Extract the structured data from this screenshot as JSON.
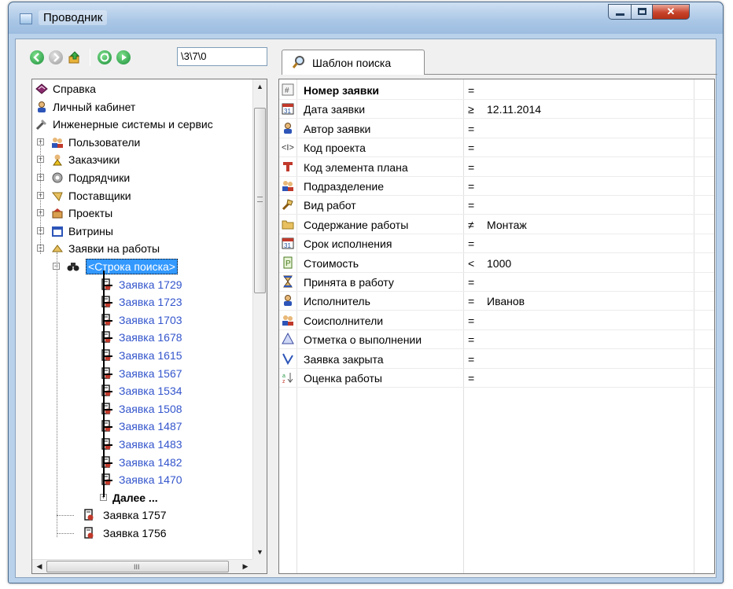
{
  "window": {
    "title": "Проводник"
  },
  "toolbar": {
    "buttons": [
      {
        "name": "back-icon",
        "color": "#2aa84a"
      },
      {
        "name": "forward-icon",
        "color": "#a9a9a9"
      },
      {
        "name": "up-folder-icon",
        "color": "#e0a020"
      },
      {
        "name": "refresh-icon",
        "color": "#2aa84a"
      },
      {
        "name": "go-icon",
        "color": "#2aa84a"
      }
    ],
    "path": "\\3\\7\\0",
    "tab_label": "Шаблон поиска"
  },
  "tree": {
    "items": [
      {
        "label": "Справка",
        "level": 0,
        "icon": "book-icon"
      },
      {
        "label": "Личный кабинет",
        "level": 0,
        "icon": "user-icon"
      },
      {
        "label": "Инженерные системы и сервис",
        "level": 0,
        "icon": "tools-icon"
      },
      {
        "label": "Пользователи",
        "level": 1,
        "icon": "users-icon",
        "expander": "+"
      },
      {
        "label": "Заказчики",
        "level": 1,
        "icon": "customer-icon",
        "expander": "+"
      },
      {
        "label": "Подрядчики",
        "level": 1,
        "icon": "contractor-icon",
        "expander": "+"
      },
      {
        "label": "Поставщики",
        "level": 1,
        "icon": "supplier-icon",
        "expander": "+"
      },
      {
        "label": "Проекты",
        "level": 1,
        "icon": "projects-icon",
        "expander": "+"
      },
      {
        "label": "Витрины",
        "level": 1,
        "icon": "showcase-icon",
        "expander": "+"
      },
      {
        "label": "Заявки на работы",
        "level": 1,
        "icon": "requests-icon",
        "expander": "−"
      },
      {
        "label": "<Строка поиска>",
        "level": 2,
        "icon": "binoculars-icon",
        "expander": "−",
        "selected": true
      },
      {
        "label": "Заявка 1729",
        "level": 3,
        "icon": "request-doc-icon",
        "link": true
      },
      {
        "label": "Заявка 1723",
        "level": 3,
        "icon": "request-doc-icon",
        "link": true
      },
      {
        "label": "Заявка 1703",
        "level": 3,
        "icon": "request-doc-icon",
        "link": true
      },
      {
        "label": "Заявка 1678",
        "level": 3,
        "icon": "request-doc-icon",
        "link": true
      },
      {
        "label": "Заявка 1615",
        "level": 3,
        "icon": "request-doc-icon",
        "link": true
      },
      {
        "label": "Заявка 1567",
        "level": 3,
        "icon": "request-doc-icon",
        "link": true
      },
      {
        "label": "Заявка 1534",
        "level": 3,
        "icon": "request-doc-icon",
        "link": true
      },
      {
        "label": "Заявка 1508",
        "level": 3,
        "icon": "request-doc-icon",
        "link": true
      },
      {
        "label": "Заявка 1487",
        "level": 3,
        "icon": "request-doc-icon",
        "link": true
      },
      {
        "label": "Заявка 1483",
        "level": 3,
        "icon": "request-doc-icon",
        "link": true
      },
      {
        "label": "Заявка 1482",
        "level": 3,
        "icon": "request-doc-icon",
        "link": true
      },
      {
        "label": "Заявка 1470",
        "level": 3,
        "icon": "request-doc-icon",
        "link": true
      },
      {
        "label": "Далее ...",
        "level": 3,
        "icon": "more-icon",
        "expander": "+",
        "bold": true
      },
      {
        "label": "Заявка 1757",
        "level": 2,
        "icon": "request-doc-icon"
      },
      {
        "label": "Заявка 1756",
        "level": 2,
        "icon": "request-doc-icon"
      }
    ]
  },
  "search_template": {
    "rows": [
      {
        "name": "Номер заявки",
        "op": "=",
        "value": "",
        "icon": "number-icon",
        "header": true
      },
      {
        "name": "Дата заявки",
        "op": "≥",
        "value": "12.11.2014",
        "icon": "calendar-icon"
      },
      {
        "name": "Автор заявки",
        "op": "=",
        "value": "",
        "icon": "author-icon"
      },
      {
        "name": "Код проекта",
        "op": "=",
        "value": "",
        "icon": "code-icon"
      },
      {
        "name": "Код элемента плана",
        "op": "=",
        "value": "",
        "icon": "plan-element-icon"
      },
      {
        "name": "Подразделение",
        "op": "=",
        "value": "",
        "icon": "department-icon"
      },
      {
        "name": "Вид работ",
        "op": "=",
        "value": "",
        "icon": "work-type-icon"
      },
      {
        "name": "Содержание работы",
        "op": "≠",
        "value": "Монтаж",
        "icon": "folder-icon"
      },
      {
        "name": "Срок исполнения",
        "op": "=",
        "value": "",
        "icon": "deadline-calendar-icon"
      },
      {
        "name": "Стоимость",
        "op": "<",
        "value": "1000",
        "icon": "cost-icon"
      },
      {
        "name": "Принята в работу",
        "op": "=",
        "value": "",
        "icon": "hourglass-icon"
      },
      {
        "name": "Исполнитель",
        "op": "=",
        "value": "Иванов",
        "icon": "executor-icon"
      },
      {
        "name": "Соисполнители",
        "op": "=",
        "value": "",
        "icon": "co-executors-icon"
      },
      {
        "name": "Отметка о выполнении",
        "op": "=",
        "value": "",
        "icon": "done-mark-icon"
      },
      {
        "name": "Заявка закрыта",
        "op": "=",
        "value": "",
        "icon": "closed-icon"
      },
      {
        "name": "Оценка работы",
        "op": "=",
        "value": "",
        "icon": "rating-icon"
      }
    ]
  },
  "scrollbar": {
    "h_grip": "III"
  }
}
